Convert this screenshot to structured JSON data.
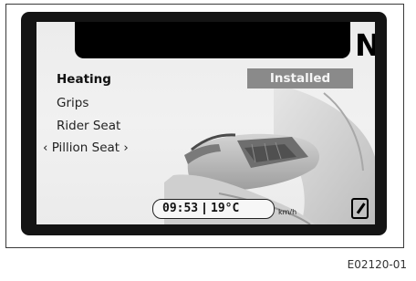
{
  "display": {
    "gear": "N",
    "menu": {
      "items": [
        {
          "label": "Heating",
          "selected": true
        },
        {
          "label": "Grips"
        },
        {
          "label": "Rider Seat"
        },
        {
          "label": "‹ Pillion Seat ›"
        }
      ]
    },
    "status_value": "Installed",
    "status_bar": {
      "time": "09:53",
      "temperature": "19°C",
      "speed_unit": "km/h"
    }
  },
  "caption": "E02120-01"
}
